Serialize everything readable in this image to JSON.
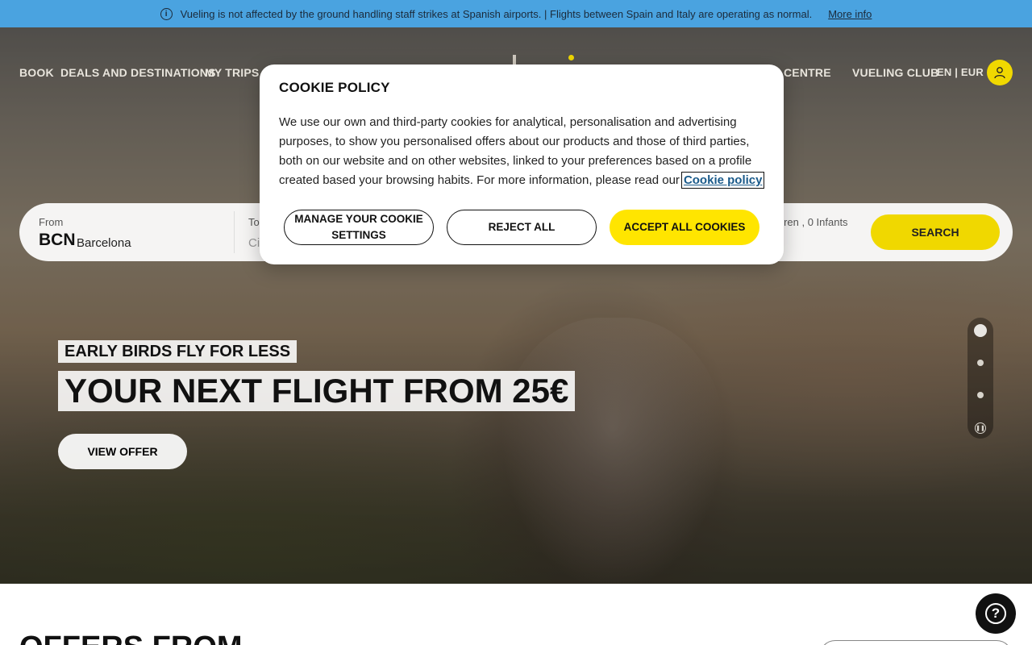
{
  "notice": {
    "message": "Vueling is not affected by the ground handling staff strikes at Spanish airports. | Flights between Spain and Italy are operating as normal.",
    "link": "More info",
    "icon": "info-icon"
  },
  "nav": {
    "book": "BOOK",
    "deals": "DEALS AND DESTINATIONS",
    "trips": "MY TRIPS",
    "help": "HELP CENTRE",
    "club": "VUELING CLUB",
    "lang": "EN | EUR",
    "user_icon": "user-icon"
  },
  "search": {
    "from_label": "From",
    "from_code": "BCN",
    "from_city": "Barcelona",
    "to_label": "To",
    "to_placeholder": "City",
    "passengers": "...dren , 0 Infants",
    "button": "SEARCH"
  },
  "promo": {
    "eyebrow": "EARLY BIRDS FLY FOR LESS",
    "headline": "YOUR NEXT FLIGHT FROM 25€",
    "button": "VIEW OFFER",
    "slides_total": 3,
    "active_slide": 1
  },
  "lower": {
    "title": "OFFERS FROM"
  },
  "cookie": {
    "title": "COOKIE POLICY",
    "body": "We use our own and third-party cookies for analytical, personalisation and advertising purposes, to show you personalised offers about our products and those of third parties, both on our website and on other websites, linked to your preferences based on a profile created based your browsing habits. For more information, please read our",
    "policy_link": "Cookie policy",
    "manage": "MANAGE YOUR COOKIE SETTINGS",
    "reject": "REJECT ALL",
    "accept": "ACCEPT ALL COOKIES"
  },
  "colors": {
    "brand_yellow": "#ffe500",
    "notice_blue": "#4aa3e0"
  }
}
